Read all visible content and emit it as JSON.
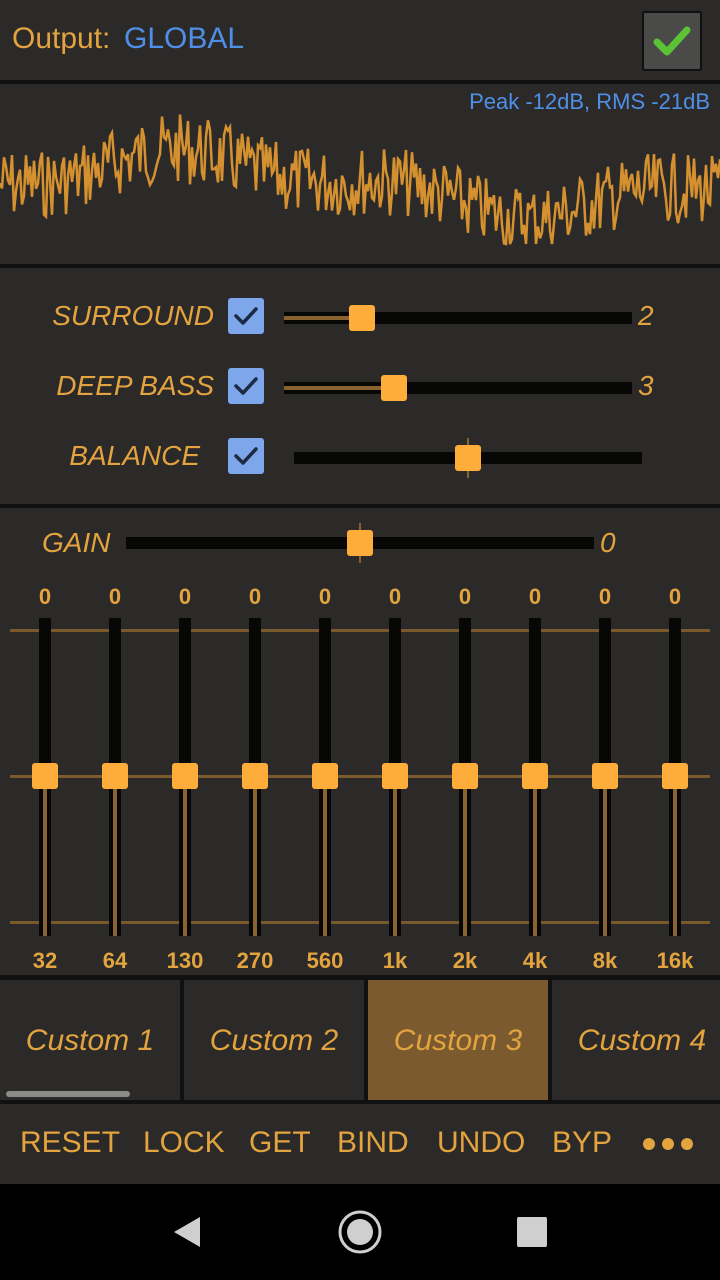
{
  "header": {
    "output_label": "Output:",
    "output_value": "GLOBAL"
  },
  "visualizer": {
    "peak_text": "Peak -12dB, RMS -21dB"
  },
  "effects": [
    {
      "label": "SURROUND",
      "checked": true,
      "value": "2"
    },
    {
      "label": "DEEP BASS",
      "checked": true,
      "value": "3"
    },
    {
      "label": "BALANCE",
      "checked": true,
      "value": ""
    }
  ],
  "gain": {
    "label": "GAIN",
    "value": "0"
  },
  "bands": [
    {
      "gain": "0",
      "freq": "32"
    },
    {
      "gain": "0",
      "freq": "64"
    },
    {
      "gain": "0",
      "freq": "130"
    },
    {
      "gain": "0",
      "freq": "270"
    },
    {
      "gain": "0",
      "freq": "560"
    },
    {
      "gain": "0",
      "freq": "1k"
    },
    {
      "gain": "0",
      "freq": "2k"
    },
    {
      "gain": "0",
      "freq": "4k"
    },
    {
      "gain": "0",
      "freq": "8k"
    },
    {
      "gain": "0",
      "freq": "16k"
    }
  ],
  "presets": [
    {
      "label": "Custom 1",
      "active": false
    },
    {
      "label": "Custom 2",
      "active": false
    },
    {
      "label": "Custom 3",
      "active": true
    },
    {
      "label": "Custom 4",
      "active": false
    }
  ],
  "actions": [
    "RESET",
    "LOCK",
    "GET",
    "BIND",
    "UNDO",
    "BYP"
  ],
  "icons": {
    "confirm": "checkmark-icon",
    "checkbox": "check-icon",
    "more": "more-dots-icon",
    "nav_back": "back-triangle-icon",
    "nav_home": "home-circle-icon",
    "nav_recents": "recents-square-icon"
  },
  "colors": {
    "accent": "#e3a33e",
    "blue": "#4f8fe8",
    "thumb": "#ffad3a",
    "checkbox": "#7ea6ea",
    "preset_active": "#7a5a2e"
  }
}
